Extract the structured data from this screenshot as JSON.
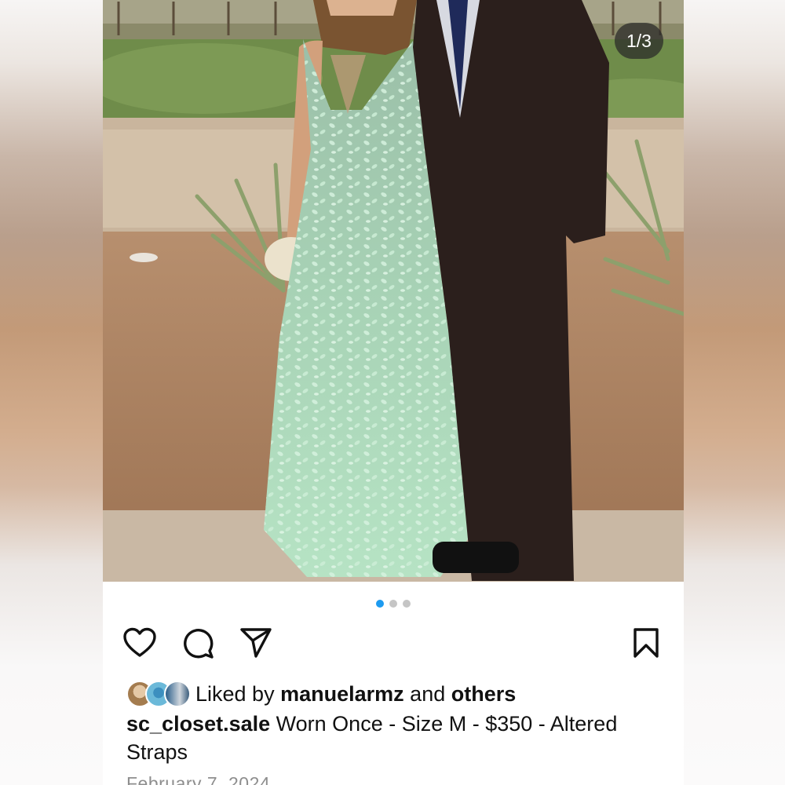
{
  "post": {
    "image_counter": "1/3",
    "carousel": {
      "total": 3,
      "active": 1
    },
    "actions": {
      "like_icon": "heart-icon",
      "comment_icon": "comment-icon",
      "share_icon": "send-icon",
      "save_icon": "bookmark-icon"
    },
    "likes": {
      "prefix": "Liked by",
      "user": "manuelarmz",
      "conjunction": "and",
      "others": "others"
    },
    "caption": {
      "username": "sc_closet.sale",
      "text": "Worn Once - Size M - $350 - Altered Straps"
    },
    "date": "February 7, 2024"
  },
  "colors": {
    "accent_dot": "#1d9bf0",
    "inactive_dot": "#c5c5c5",
    "icon": "#111111",
    "secondary_text": "#8e8e8e"
  }
}
